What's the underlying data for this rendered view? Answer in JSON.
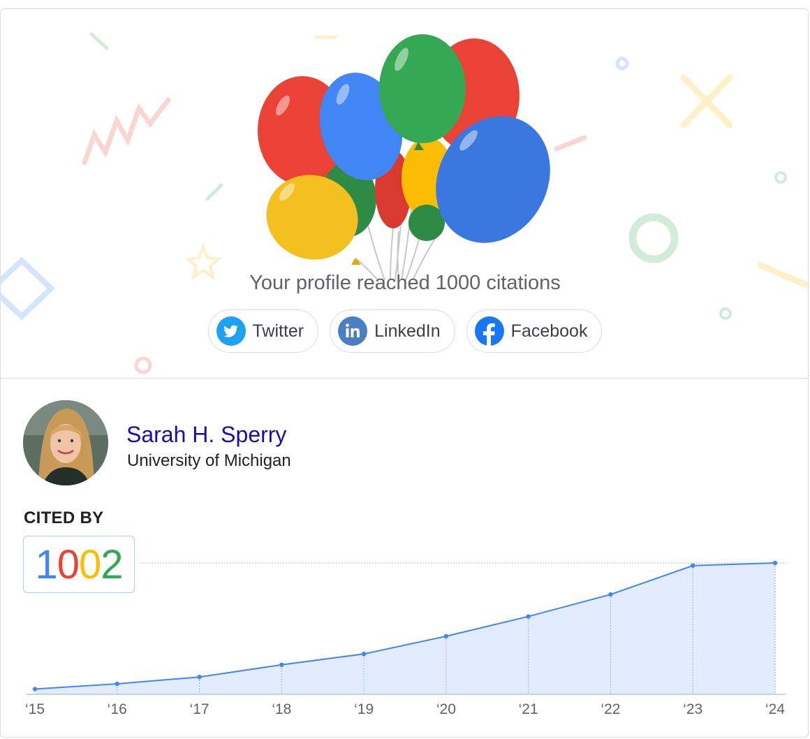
{
  "celebration": {
    "headline": "Your profile reached 1000 citations",
    "share_buttons": [
      {
        "label": "Twitter",
        "icon": "twitter-icon",
        "color": "#1da1f2"
      },
      {
        "label": "LinkedIn",
        "icon": "linkedin-icon",
        "color": "#4a7fc1"
      },
      {
        "label": "Facebook",
        "icon": "facebook-icon",
        "color": "#1877f2"
      }
    ],
    "balloon_colors": [
      "#ea4335",
      "#4285f4",
      "#34a853",
      "#fbbc04"
    ]
  },
  "profile": {
    "name": "Sarah H. Sperry",
    "affiliation": "University of Michigan"
  },
  "cited_by": {
    "label": "CITED BY",
    "count_digits": [
      {
        "d": "1",
        "color": "#4285f4"
      },
      {
        "d": "0",
        "color": "#ea4335"
      },
      {
        "d": "0",
        "color": "#fbbc04"
      },
      {
        "d": "2",
        "color": "#34a853"
      }
    ]
  },
  "chart_data": {
    "type": "area",
    "x": [
      "‘15",
      "‘16",
      "‘17",
      "‘18",
      "‘19",
      "‘20",
      "‘21",
      "‘22",
      "‘23",
      "‘24"
    ],
    "values": [
      40,
      80,
      132,
      225,
      308,
      443,
      594,
      762,
      982,
      1002
    ],
    "ylim": [
      0,
      1002
    ],
    "line_color": "#4285f4",
    "fill_color": "#e3ecfc",
    "title": "",
    "xlabel": "",
    "ylabel": ""
  }
}
